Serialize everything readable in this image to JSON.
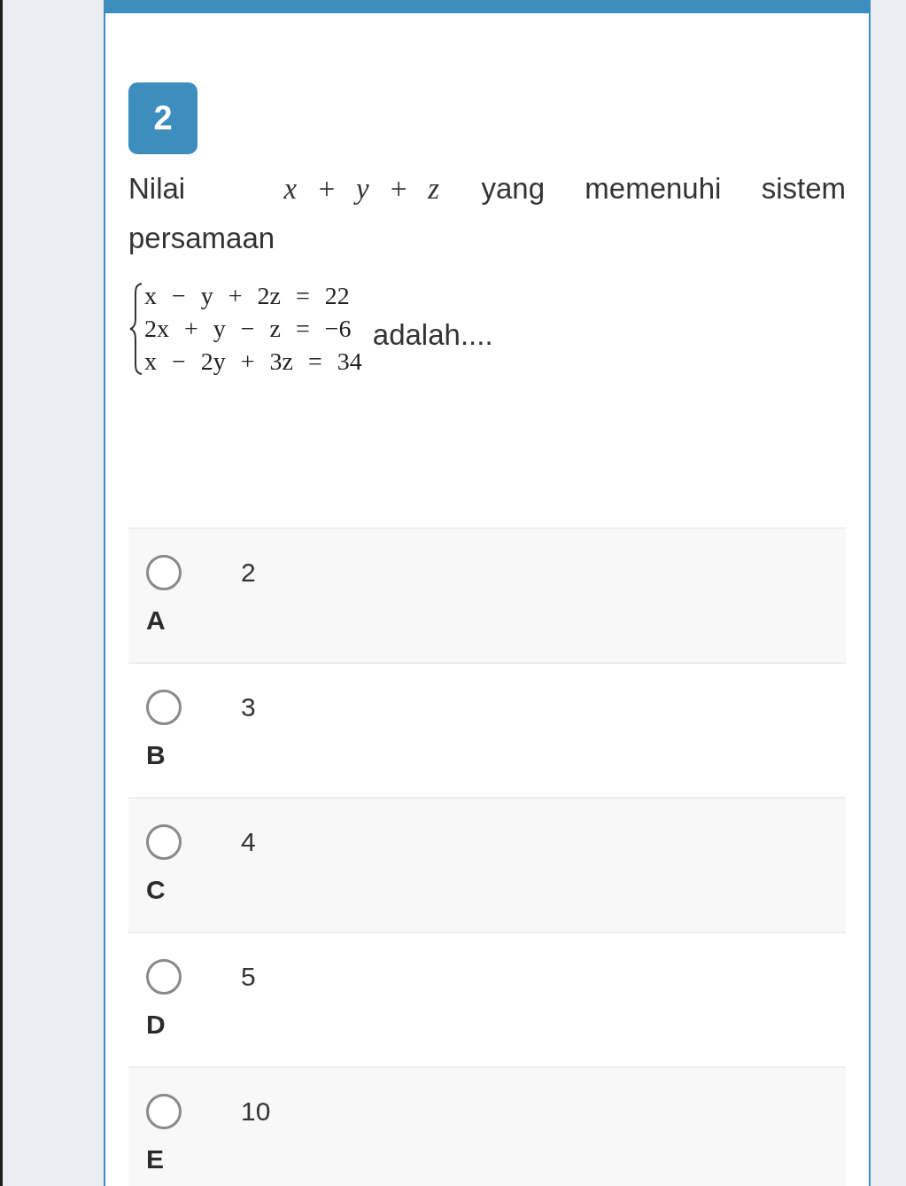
{
  "question": {
    "number": "2",
    "stem": [
      {
        "kind": "text",
        "text": "Nilai"
      },
      {
        "kind": "math",
        "text": "x + y + z"
      },
      {
        "kind": "text",
        "text": "yang memenuhi sistem persamaan"
      }
    ],
    "equations": [
      "x − y + 2z = 22",
      "2x + y − z = −6",
      "x − 2y + 3z = 34"
    ],
    "ending": "adalah...."
  },
  "options": [
    {
      "letter": "A",
      "value": "2",
      "selected": false
    },
    {
      "letter": "B",
      "value": "3",
      "selected": false
    },
    {
      "letter": "C",
      "value": "4",
      "selected": false
    },
    {
      "letter": "D",
      "value": "5",
      "selected": false
    },
    {
      "letter": "E",
      "value": "10",
      "selected": false
    }
  ]
}
